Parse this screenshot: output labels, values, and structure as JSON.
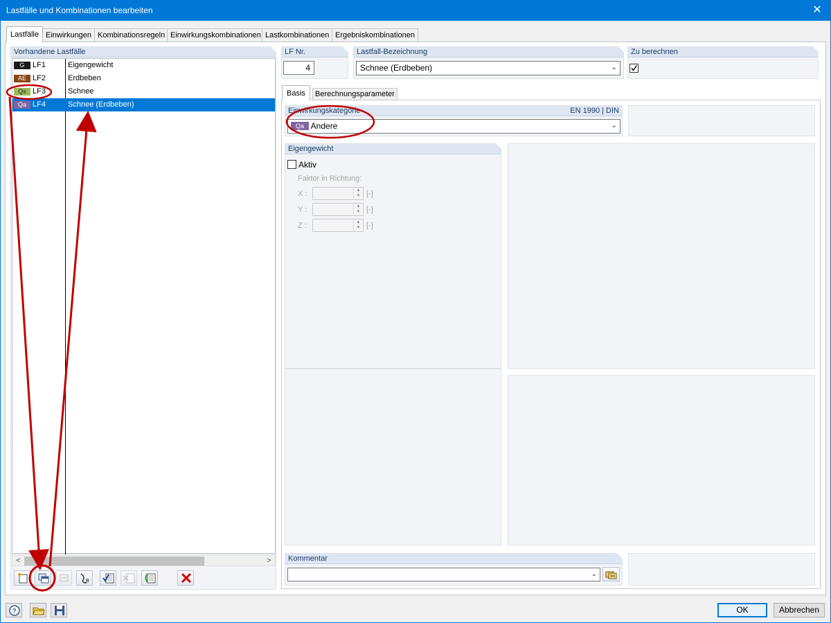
{
  "window": {
    "title": "Lastfälle und Kombinationen bearbeiten",
    "close_glyph": "✕"
  },
  "tabs": [
    "Lastfälle",
    "Einwirkungen",
    "Kombinationsregeln",
    "Einwirkungskombinationen",
    "Lastkombinationen",
    "Ergebniskombinationen"
  ],
  "list": {
    "header": "Vorhandene Lastfälle",
    "rows": [
      {
        "badge": "G",
        "badge_bg": "#1a1a1a",
        "badge_fg": "#ffffff",
        "id": "LF1",
        "name": "Eigengewicht",
        "selected": false
      },
      {
        "badge": "AE",
        "badge_bg": "#8b4513",
        "badge_fg": "#ffffff",
        "id": "LF2",
        "name": "Erdbeben",
        "selected": false
      },
      {
        "badge": "Qs",
        "badge_bg": "#9bbb59",
        "badge_fg": "#1a1a1a",
        "id": "LF3",
        "name": "Schnee",
        "selected": false
      },
      {
        "badge": "Qa",
        "badge_bg": "#8064a2",
        "badge_fg": "#ffffff",
        "id": "LF4",
        "name": "Schnee (Erdbeben)",
        "selected": true
      }
    ],
    "scroll_left": "<",
    "scroll_right": ">"
  },
  "lf_nr": {
    "label": "LF Nr.",
    "value": "4"
  },
  "bezeichnung": {
    "label": "Lastfall-Bezeichnung",
    "value": "Schnee (Erdbeben)"
  },
  "zu_berechnen": {
    "label": "Zu berechnen",
    "checked": true
  },
  "subtabs": [
    "Basis",
    "Berechnungsparameter"
  ],
  "einwirkung": {
    "label": "Einwirkungskategorie",
    "norm": "EN 1990 | DIN",
    "badge": "Qa",
    "badge_bg": "#8064a2",
    "value": "Andere"
  },
  "eigengewicht": {
    "label": "Eigengewicht",
    "aktiv_label": "Aktiv",
    "aktiv_checked": false,
    "faktor_label": "Faktor in Richtung:",
    "axes": [
      {
        "axis": "X :",
        "unit": "[-]"
      },
      {
        "axis": "Y :",
        "unit": "[-]"
      },
      {
        "axis": "Z :",
        "unit": "[-]"
      }
    ]
  },
  "kommentar": {
    "label": "Kommentar",
    "value": ""
  },
  "buttons": {
    "ok": "OK",
    "cancel": "Abbrechen"
  },
  "colors": {
    "accent": "#0078d7",
    "annotation": "#c00000"
  }
}
